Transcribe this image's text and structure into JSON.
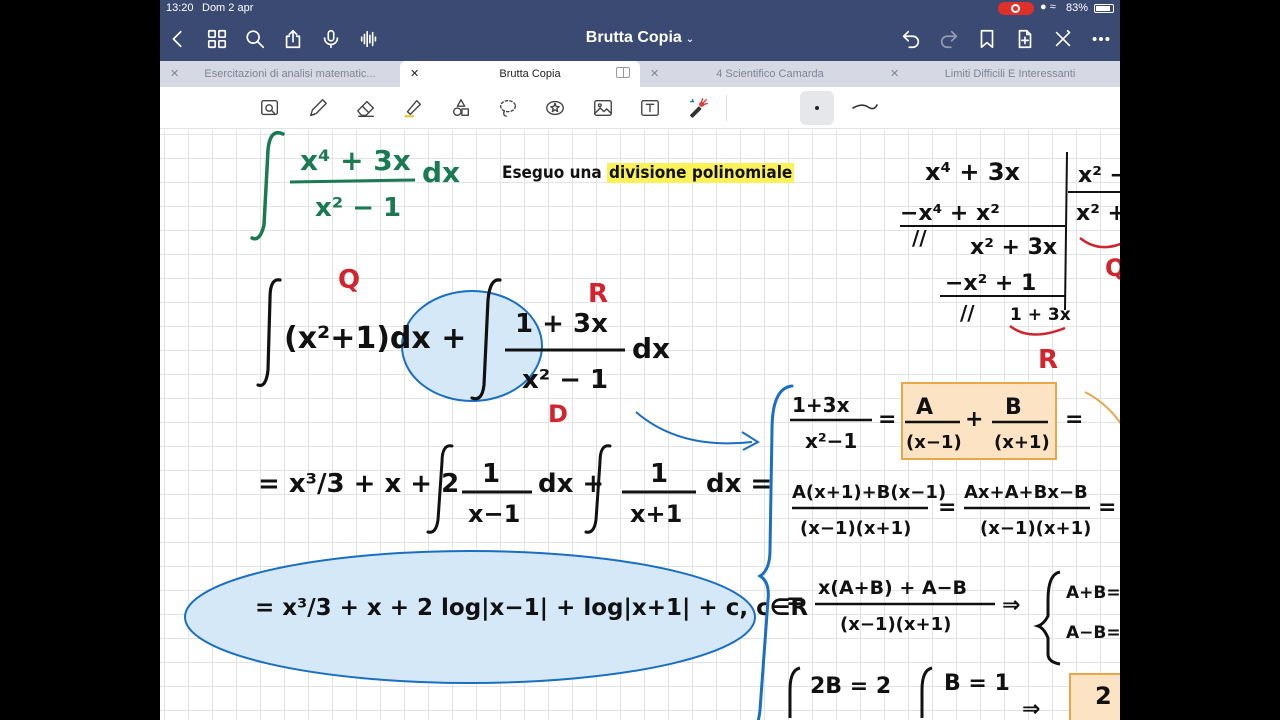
{
  "status": {
    "time": "13:20",
    "date": "Dom 2 apr",
    "battery": "83%"
  },
  "nav": {
    "title": "Brutta Copia"
  },
  "tabs": [
    {
      "label": "Esercitazioni di analisi matematic..."
    },
    {
      "label": "Brutta Copia",
      "active": true
    },
    {
      "label": "4 Scientifico Camarda"
    },
    {
      "label": "Limiti Difficili E Interessanti"
    }
  ],
  "icons": {
    "back": "chevron-left-icon",
    "grid": "grid-icon",
    "search": "search-icon",
    "share": "share-icon",
    "mic": "microphone-icon",
    "audio": "waveform-icon",
    "undo": "undo-icon",
    "redo": "redo-icon",
    "bookmark": "bookmark-icon",
    "addpage": "add-page-icon",
    "close": "close-icon",
    "more": "more-icon"
  },
  "colors": {
    "nav": "#3a4a73",
    "ink_green": "#1a7a52",
    "ink_red": "#d0242e",
    "ink_blue": "#1a6fc0",
    "highlight": "#fbf25a",
    "box_orange": "#e9a64a"
  },
  "notes": {
    "text_plain": "Eseguo una ",
    "text_highlight": "divisione polinomiale",
    "integral_num": "x⁴ + 3x",
    "integral_den": "x² − 1",
    "dx": "dx",
    "q_label": "Q",
    "r_label": "R",
    "d_label": "D",
    "q_expr": "(x²+1)dx +",
    "r_num": "1 + 3x",
    "r_den": "x² − 1",
    "line2_a": "= x³/3 + x + 2",
    "line2_num1": "1",
    "line2_den1": "x−1",
    "line2_num2": "1",
    "line2_den2": "x+1",
    "line2_plus": "dx +",
    "line2_end": "dx =",
    "line3": "= x³/3 + x + 2 log|x−1| + log|x+1| + c, c∈R",
    "div_row1": "x⁴ +      3x",
    "div_row2": "−x⁴ + x²",
    "div_row3": "x² +  3x",
    "div_row4": "−x² + 1",
    "div_row5": "1 + 3x",
    "div_divisor": "x² −",
    "div_quot": "x² +",
    "div_slash": "//",
    "pf_lhs_num": "1+3x",
    "pf_lhs_den": "x²−1",
    "pf_a": "A",
    "pf_a_den": "(x−1)",
    "pf_b": "B",
    "pf_b_den": "(x+1)",
    "pf2_num": "A(x+1)+B(x−1)",
    "pf2_den": "(x−1)(x+1)",
    "pf2_num_b": "Ax+A+Bx−B",
    "pf2_den_b": "(x−1)(x+1)",
    "pf3_num": "x(A+B) + A−B",
    "pf3_den": "(x−1)(x+1)",
    "pf3_sys1": "A+B=",
    "pf3_sys2": "A−B=",
    "pf4_a": "2B = 2",
    "pf4_b": "B = 1",
    "pf4_c": "2"
  }
}
